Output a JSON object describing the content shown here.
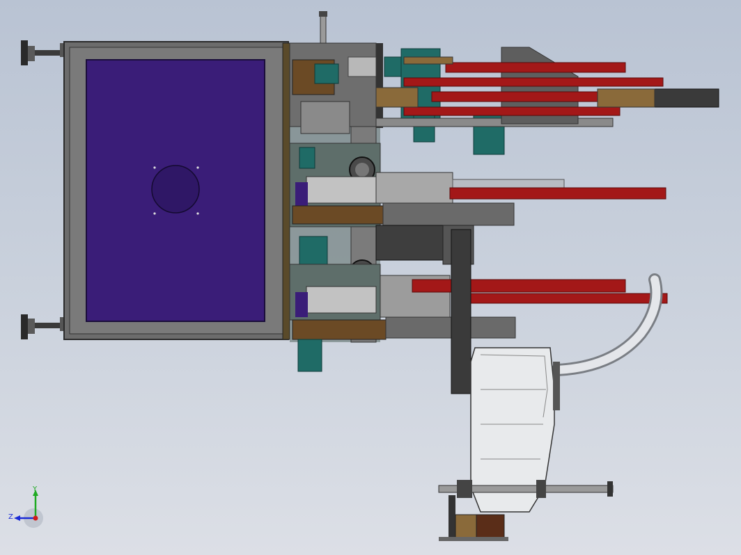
{
  "view": {
    "type": "CAD assembly view",
    "background_top": "#b9c3d3",
    "background_bottom": "#dcdfe6"
  },
  "colors": {
    "frame": "#6a6a6a",
    "panel": "#3a1d78",
    "red_bar": "#a31818",
    "teal": "#1f6b66",
    "brown": "#6b4a25",
    "silver": "#cfd3d8",
    "dark": "#2e2e2e"
  },
  "triad": {
    "x_label": "",
    "y_label": "Y",
    "z_label": "Z",
    "y_color": "#1faa22",
    "z_color": "#1a2bd6",
    "origin_color": "#d11a1a"
  }
}
